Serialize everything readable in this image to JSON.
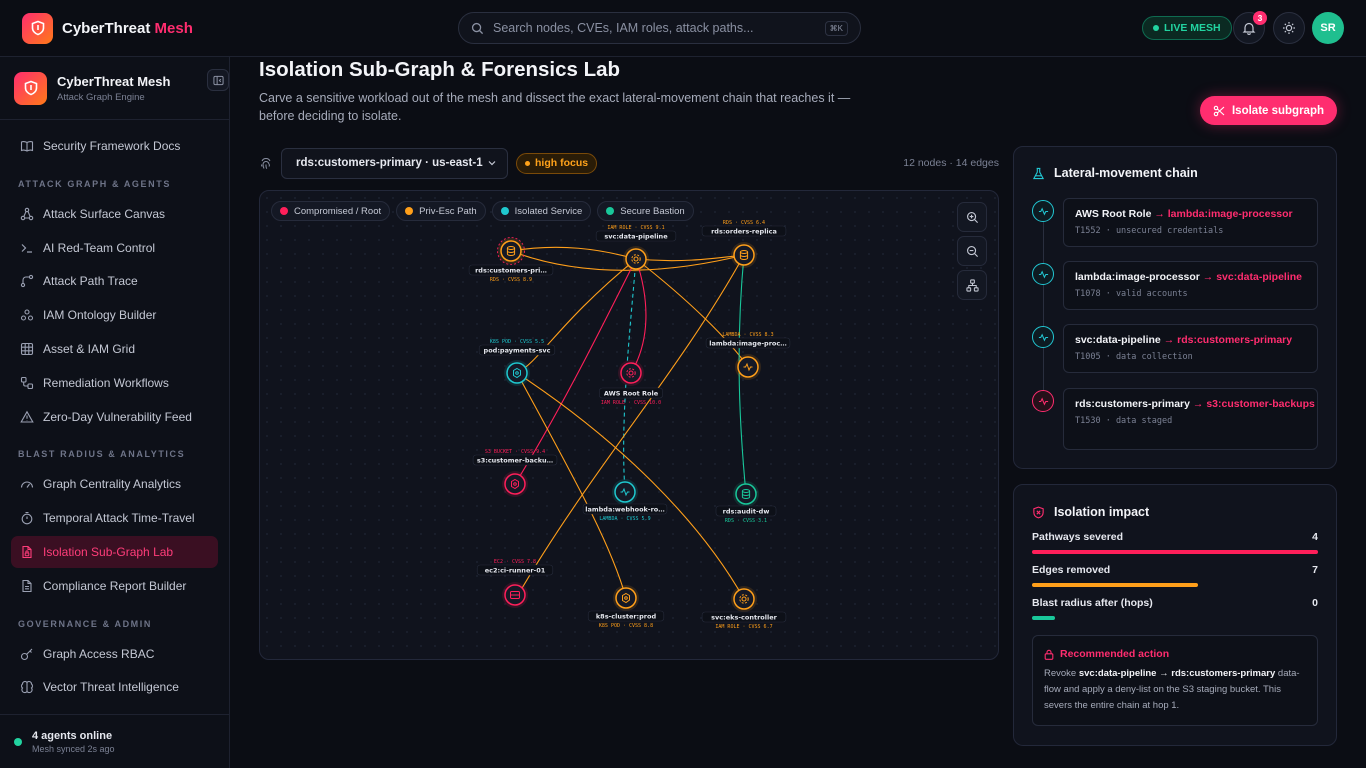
{
  "app": {
    "name": "CyberThreat",
    "name_accent": "Mesh"
  },
  "search": {
    "placeholder": "Search nodes, CVEs, IAM roles, attack paths...",
    "shortcut": "⌘K"
  },
  "header": {
    "live_label": "LIVE MESH",
    "notifications": "3",
    "avatar": "SR"
  },
  "sidebar": {
    "title": "CyberThreat Mesh",
    "subtitle": "Attack Graph Engine",
    "top_item": "Security Framework Docs",
    "section1": "ATTACK GRAPH & AGENTS",
    "items1": [
      "Attack Surface Canvas",
      "AI Red-Team Control",
      "Attack Path Trace",
      "IAM Ontology Builder",
      "Asset & IAM Grid",
      "Remediation Workflows",
      "Zero-Day Vulnerability Feed"
    ],
    "section2": "BLAST RADIUS & ANALYTICS",
    "items2": [
      "Graph Centrality Analytics",
      "Temporal Attack Time-Travel",
      "Isolation Sub-Graph Lab",
      "Compliance Report Builder"
    ],
    "section3": "GOVERNANCE & ADMIN",
    "items3": [
      "Graph Access RBAC",
      "Vector Threat Intelligence"
    ],
    "footer_title": "4 agents online",
    "footer_sub": "Mesh synced 2s ago"
  },
  "page": {
    "title": "Isolation Sub-Graph & Forensics Lab",
    "description": "Carve a sensitive workload out of the mesh and dissect the exact lateral-movement chain that reaches it — before deciding to isolate.",
    "action": "Isolate subgraph",
    "target": "rds:customers-primary · us-east-1",
    "focus": "high focus",
    "counts": "12 nodes · 14 edges"
  },
  "legend": [
    {
      "label": "Compromised / Root",
      "color": "#ff1f5a"
    },
    {
      "label": "Priv-Esc Path",
      "color": "#ff9f1a"
    },
    {
      "label": "Isolated Service",
      "color": "#1fc8cf"
    },
    {
      "label": "Secure Bastion",
      "color": "#19c79a"
    }
  ],
  "graph_nodes": [
    {
      "name": "rds:customers-pri…",
      "meta": "RDS · CVSS 8.9",
      "kind": "db",
      "color": "#ff9f1a"
    },
    {
      "name": "svc:data-pipeline",
      "meta": "IAM ROLE · CVSS 9.1",
      "kind": "svc",
      "color": "#ff9f1a"
    },
    {
      "name": "rds:orders-replica",
      "meta": "RDS · CVSS 6.4",
      "kind": "db",
      "color": "#ff9f1a"
    },
    {
      "name": "pod:payments-svc",
      "meta": "K8S POD · CVSS 5.5",
      "kind": "pod",
      "color": "#1fc8cf"
    },
    {
      "name": "AWS Root Role",
      "meta": "IAM ROLE · CVSS 10.0",
      "kind": "svc",
      "color": "#ff1f5a"
    },
    {
      "name": "lambda:image-proc…",
      "meta": "LAMBDA · CVSS 8.3",
      "kind": "fn",
      "color": "#ff9f1a"
    },
    {
      "name": "s3:customer-backu…",
      "meta": "S3 BUCKET · CVSS 9.4",
      "kind": "pod",
      "color": "#ff1f5a"
    },
    {
      "name": "lambda:webhook-ro…",
      "meta": "LAMBDA · CVSS 5.9",
      "kind": "fn",
      "color": "#1fc8cf"
    },
    {
      "name": "rds:audit-dw",
      "meta": "RDS · CVSS 3.1",
      "kind": "db",
      "color": "#19c79a"
    },
    {
      "name": "ec2:ci-runner-01",
      "meta": "EC2 · CVSS 7.8",
      "kind": "vm",
      "color": "#ff1f5a"
    },
    {
      "name": "k8s-cluster:prod",
      "meta": "K8S POD · CVSS 8.8",
      "kind": "pod",
      "color": "#ff9f1a"
    },
    {
      "name": "svc:eks-controller",
      "meta": "IAM ROLE · CVSS 6.7",
      "kind": "svc",
      "color": "#ff9f1a"
    }
  ],
  "chain": {
    "title": "Lateral-movement chain",
    "steps": [
      {
        "from": "AWS Root Role",
        "arrow": "→",
        "to": "lambda:image-processor",
        "detail": "T1552 · unsecured credentials",
        "color": "#22c7d3"
      },
      {
        "from": "lambda:image-processor",
        "arrow": "→",
        "to": "svc:data-pipeline",
        "detail": "T1078 · valid accounts",
        "color": "#22c7d3"
      },
      {
        "from": "svc:data-pipeline",
        "arrow": "→",
        "to": "rds:customers-primary",
        "detail": "T1005 · data collection",
        "color": "#22c7d3"
      },
      {
        "from": "rds:customers-primary",
        "arrow": "→",
        "to": "s3:customer-backups",
        "detail": "T1530 · data staged",
        "color": "#ff2d6f"
      }
    ]
  },
  "impact": {
    "title": "Isolation impact",
    "metrics": [
      {
        "label": "Pathways severed",
        "value": "4",
        "fill": 1.0,
        "color": "#ff1f5a"
      },
      {
        "label": "Edges removed",
        "value": "7",
        "fill": 0.58,
        "color": "#ff9f1a"
      },
      {
        "label": "Blast radius after (hops)",
        "value": "0",
        "fill": 0.08,
        "color": "#19c79a"
      }
    ],
    "rec_title": "Recommended action",
    "rec_prefix": "Revoke",
    "rec_bold": "svc:data-pipeline → rds:customers-primary",
    "rec_suffix": "data-flow and apply a deny-list on the S3 staging bucket. This severs the entire chain at hop 1."
  }
}
